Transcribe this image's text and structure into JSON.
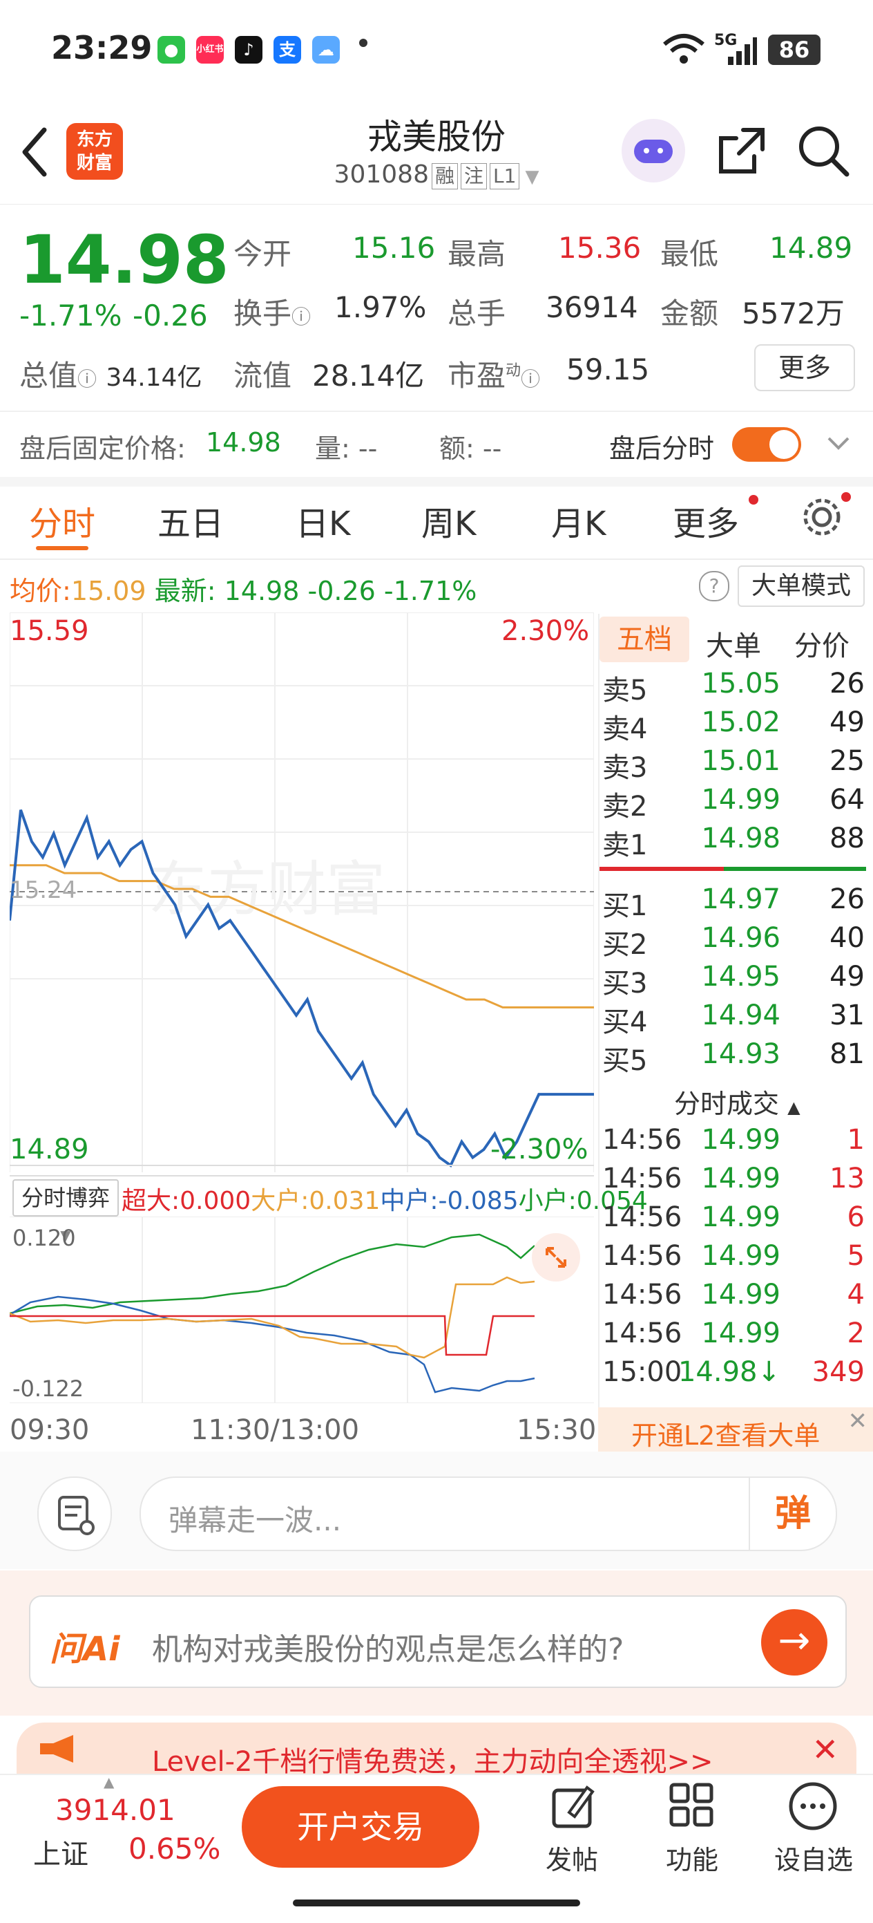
{
  "status_bar": {
    "time": "23:29",
    "network": "5G",
    "battery": "86",
    "app_icons": [
      "wechat-icon",
      "xiaohongshu-icon",
      "douyin-icon",
      "alipay-icon",
      "weather-icon"
    ],
    "small_labels": {
      "xiaohongshu": "小红书",
      "alipay": "支"
    }
  },
  "header": {
    "back_icon": "back-arrow-icon",
    "logo_text_1": "东方",
    "logo_text_2": "财富",
    "title": "戎美股份",
    "code": "301088",
    "tags": [
      "融",
      "注",
      "L1"
    ],
    "robot_icon": "ai-robot-icon",
    "share_icon": "share-icon",
    "search_icon": "search-icon"
  },
  "quote": {
    "price": "14.98",
    "change_pct": "-1.71%",
    "change": "-0.26",
    "open_label": "今开",
    "open": "15.16",
    "high_label": "最高",
    "high": "15.36",
    "low_label": "最低",
    "low": "14.89",
    "turnover_label": "换手",
    "turnover": "1.97%",
    "volume_label": "总手",
    "volume": "36914",
    "amount_label": "金额",
    "amount": "5572万",
    "mktcap_label": "总值",
    "mktcap": "34.14亿",
    "float_label": "流值",
    "float": "28.14亿",
    "pe_label": "市盈",
    "pe_sup": "动",
    "pe": "59.15",
    "more_button": "更多"
  },
  "after_hours": {
    "fixed_price_label": "盘后固定价格:",
    "fixed_price": "14.98",
    "vol_label": "量:",
    "vol": "--",
    "amt_label": "额:",
    "amt": "--",
    "toggle_label": "盘后分时"
  },
  "tabs": [
    "分时",
    "五日",
    "日K",
    "周K",
    "月K",
    "更多"
  ],
  "avg_line": {
    "avg_label": "均价:",
    "avg": "15.09",
    "latest_label": "最新:",
    "latest": "14.98",
    "chg": "-0.26",
    "chg_pct": "-1.71%",
    "mode_button": "大单模式"
  },
  "chart": {
    "y_top": "15.59",
    "y_top_pct": "2.30%",
    "y_bottom": "14.89",
    "y_bottom_pct": "-2.30%",
    "y_mid": "15.24",
    "watermark": "东方财富",
    "x_labels": [
      "09:30",
      "11:30/13:00",
      "15:30"
    ],
    "price_series": [
      15.2,
      15.34,
      15.3,
      15.28,
      15.31,
      15.27,
      15.3,
      15.33,
      15.28,
      15.3,
      15.27,
      15.29,
      15.3,
      15.26,
      15.24,
      15.22,
      15.18,
      15.2,
      15.22,
      15.19,
      15.2,
      15.18,
      15.16,
      15.14,
      15.12,
      15.1,
      15.08,
      15.1,
      15.06,
      15.04,
      15.02,
      15.0,
      15.02,
      14.98,
      14.96,
      14.94,
      14.96,
      14.93,
      14.92,
      14.9,
      14.89,
      14.92,
      14.9,
      14.91,
      14.93,
      14.9,
      14.92,
      14.95,
      14.98,
      14.98,
      14.98,
      14.98,
      14.98,
      14.98
    ],
    "avg_series": [
      15.27,
      15.27,
      15.27,
      15.26,
      15.26,
      15.26,
      15.25,
      15.25,
      15.25,
      15.24,
      15.24,
      15.23,
      15.23,
      15.22,
      15.21,
      15.2,
      15.19,
      15.18,
      15.17,
      15.16,
      15.15,
      15.14,
      15.13,
      15.12,
      15.11,
      15.1,
      15.1,
      15.09,
      15.09,
      15.09,
      15.09,
      15.09,
      15.09
    ]
  },
  "flow": {
    "selector": "分时博弈",
    "super_label": "超大:",
    "super": "0.000",
    "large_label": "大户:",
    "large": "0.031",
    "mid_label": "中户:",
    "mid": "-0.085",
    "small_label": "小户:",
    "small": "0.054",
    "y_top": "0.120",
    "y_bottom": "-0.122",
    "expand_icon": "expand-icon"
  },
  "orderbook": {
    "tabs": [
      "五档",
      "大单",
      "分价"
    ],
    "sells": [
      {
        "label": "卖5",
        "price": "15.05",
        "vol": "26"
      },
      {
        "label": "卖4",
        "price": "15.02",
        "vol": "49"
      },
      {
        "label": "卖3",
        "price": "15.01",
        "vol": "25"
      },
      {
        "label": "卖2",
        "price": "14.99",
        "vol": "64"
      },
      {
        "label": "卖1",
        "price": "14.98",
        "vol": "88"
      }
    ],
    "buys": [
      {
        "label": "买1",
        "price": "14.97",
        "vol": "26"
      },
      {
        "label": "买2",
        "price": "14.96",
        "vol": "40"
      },
      {
        "label": "买3",
        "price": "14.95",
        "vol": "49"
      },
      {
        "label": "买4",
        "price": "14.94",
        "vol": "31"
      },
      {
        "label": "买5",
        "price": "14.93",
        "vol": "81"
      }
    ],
    "ticks_header": "分时成交",
    "ticks": [
      {
        "time": "14:56",
        "price": "14.99",
        "vol": "1"
      },
      {
        "time": "14:56",
        "price": "14.99",
        "vol": "13"
      },
      {
        "time": "14:56",
        "price": "14.99",
        "vol": "6"
      },
      {
        "time": "14:56",
        "price": "14.99",
        "vol": "5"
      },
      {
        "time": "14:56",
        "price": "14.99",
        "vol": "4"
      },
      {
        "time": "14:56",
        "price": "14.99",
        "vol": "2"
      },
      {
        "time": "15:00",
        "price": "14.98↓",
        "vol": "349"
      }
    ],
    "l2_banner": "开通L2查看大单"
  },
  "danmu": {
    "placeholder": "弹幕走一波...",
    "button": "弹"
  },
  "ai": {
    "logo": "问Ai",
    "question": "机构对戎美股份的观点是怎么样的?"
  },
  "promo": {
    "text": "Level-2千档行情免费送，主力动向全透视>>"
  },
  "bottom": {
    "index_value": "3914.01",
    "index_name": "上证",
    "index_pct": "0.65%",
    "trade_button": "开户交易",
    "post": "发帖",
    "functions": "功能",
    "watchlist": "设自选"
  },
  "colors": {
    "up": "#e0282e",
    "down": "#1a9a2e",
    "accent": "#f26b1d",
    "price_line": "#2a66b8",
    "avg_line": "#e8a23a"
  }
}
